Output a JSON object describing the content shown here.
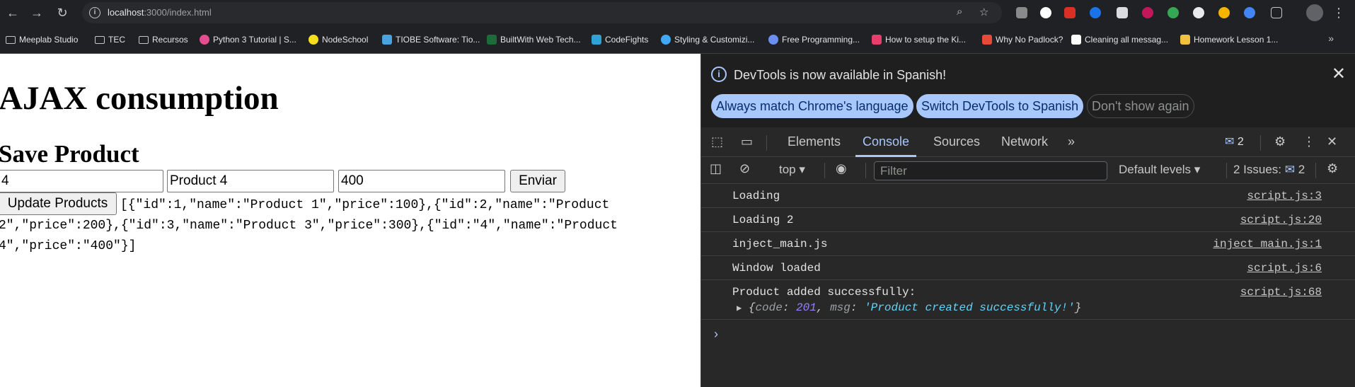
{
  "browser": {
    "url_host": "localhost",
    "url_rest": ":3000/index.html"
  },
  "bookmarks": [
    {
      "label": "Meeplab Studio",
      "kind": "folder"
    },
    {
      "label": "TEC",
      "kind": "folder"
    },
    {
      "label": "Recursos",
      "kind": "folder"
    },
    {
      "label": "Python 3 Tutorial | S...",
      "kind": "site",
      "color": "#e44d8e"
    },
    {
      "label": "NodeSchool",
      "kind": "site",
      "color": "#f7df1e"
    },
    {
      "label": "TIOBE Software: Tio...",
      "kind": "site",
      "color": "#4aa3df"
    },
    {
      "label": "BuiltWith Web Tech...",
      "kind": "site",
      "color": "#1e6b3a"
    },
    {
      "label": "CodeFights",
      "kind": "site",
      "color": "#2ea3d6"
    },
    {
      "label": "Styling & Customizi...",
      "kind": "site",
      "color": "#3fa9f5"
    },
    {
      "label": "Free Programming...",
      "kind": "site",
      "color": "#6b8ef2"
    },
    {
      "label": "How to setup the Ki...",
      "kind": "site",
      "color": "#e83e6c"
    },
    {
      "label": "Why No Padlock?",
      "kind": "site",
      "color": "#e84a3a"
    },
    {
      "label": "Cleaning all messag...",
      "kind": "site",
      "color": "#ffffff"
    },
    {
      "label": "Homework Lesson 1...",
      "kind": "site",
      "color": "#f0c040"
    }
  ],
  "page": {
    "title": "AJAX consumption",
    "subtitle": "Save Product",
    "input_id": "4",
    "input_name": "Product 4",
    "input_price": "400",
    "submit_label": "Enviar",
    "update_label": "Update Products",
    "json_line1": "[{\"id\":1,\"name\":\"Product 1\",\"price\":100},{\"id\":2,\"name\":\"Product",
    "json_line2": "2\",\"price\":200},{\"id\":3,\"name\":\"Product 3\",\"price\":300},{\"id\":\"4\",\"name\":\"Product",
    "json_line3": "4\",\"price\":\"400\"}]"
  },
  "devtools": {
    "notice": "DevTools is now available in Spanish!",
    "btn_match": "Always match Chrome's language",
    "btn_switch": "Switch DevTools to Spanish",
    "btn_dismiss": "Don't show again",
    "tabs": [
      "Elements",
      "Console",
      "Sources",
      "Network"
    ],
    "issues_badge": "2",
    "context": "top",
    "filter_placeholder": "Filter",
    "levels": "Default levels",
    "issues_label": "2 Issues:",
    "issues_count": "2",
    "logs": [
      {
        "text": "Loading",
        "source": "script.js:3"
      },
      {
        "text": "Loading 2",
        "source": "script.js:20"
      },
      {
        "text": "inject_main.js",
        "source": "inject_main.js:1"
      },
      {
        "text": "Window loaded",
        "source": "script.js:6"
      },
      {
        "text": "Product added successfully:",
        "source": "script.js:68"
      }
    ],
    "obj_code_key": "code",
    "obj_code_val": "201",
    "obj_msg_key": "msg",
    "obj_msg_val": "'Product created successfully!'"
  }
}
